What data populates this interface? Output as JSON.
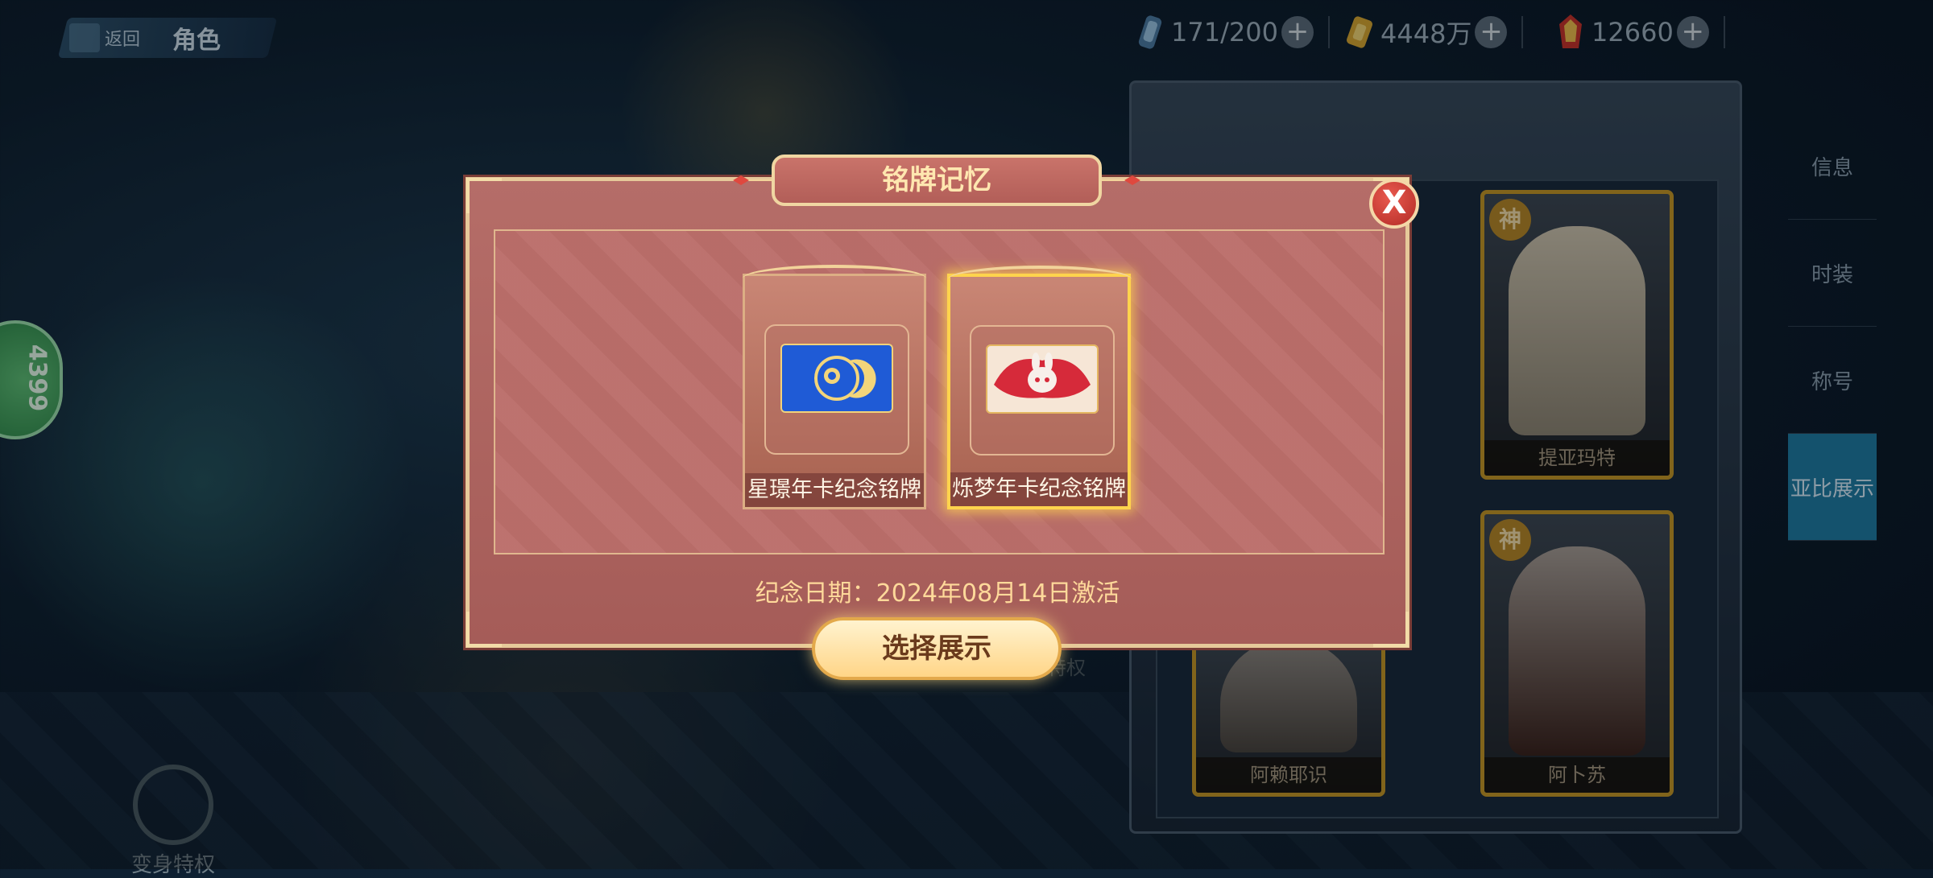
{
  "header": {
    "back_label": "返回",
    "page_title": "角色",
    "resources": [
      {
        "icon": "stamina-icon",
        "value": "171/200"
      },
      {
        "icon": "gold-coin-icon",
        "value": "4448万"
      },
      {
        "icon": "crystal-icon",
        "value": "12660"
      }
    ],
    "plus_symbol": "+"
  },
  "left_badge": {
    "value": "4399"
  },
  "side_tabs": [
    {
      "label": "信息",
      "active": false
    },
    {
      "label": "时装",
      "active": false
    },
    {
      "label": "称号",
      "active": false
    },
    {
      "label": "亚比展示",
      "active": true
    }
  ],
  "characters": [
    {
      "badge": "神",
      "name": "提亚玛特"
    },
    {
      "badge": "神",
      "name": "阿卜苏"
    },
    {
      "badge": "",
      "name": "阿赖耶识"
    }
  ],
  "background_labels": {
    "privilege": "我的特权",
    "transform_privilege": "变身特权"
  },
  "modal": {
    "title": "铭牌记忆",
    "close_symbol": "X",
    "plaques": [
      {
        "label": "星璟年卡纪念铭牌",
        "selected": false,
        "art": "star-moon-plaque-art"
      },
      {
        "label": "烁梦年卡纪念铭牌",
        "selected": true,
        "art": "dream-rabbit-plaque-art"
      }
    ],
    "date_text": "纪念日期：2024年08月14日激活",
    "action_label": "选择展示"
  },
  "colors": {
    "modal_bg": "#b06663",
    "frame_gold": "#e6c99a",
    "selected_glow": "#ffd34d",
    "side_tab_active": "#1f7ea8",
    "close_red": "#d2403a"
  }
}
